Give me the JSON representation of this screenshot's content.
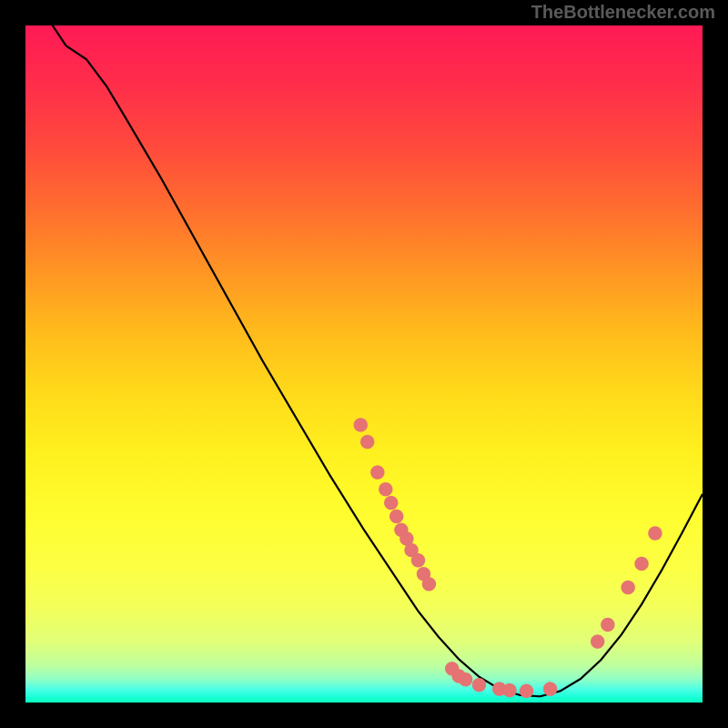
{
  "watermark": "TheBottlenecker.com",
  "chart_data": {
    "type": "line",
    "title": "",
    "xlabel": "",
    "ylabel": "",
    "xlim": [
      0,
      100
    ],
    "ylim": [
      0,
      100
    ],
    "background": {
      "gradient_stops": [
        {
          "offset": 0.0,
          "color": "#ff1a55"
        },
        {
          "offset": 0.09,
          "color": "#ff2e4a"
        },
        {
          "offset": 0.18,
          "color": "#ff4a3c"
        },
        {
          "offset": 0.27,
          "color": "#ff6d2f"
        },
        {
          "offset": 0.36,
          "color": "#ff9424"
        },
        {
          "offset": 0.45,
          "color": "#ffba1c"
        },
        {
          "offset": 0.54,
          "color": "#ffd91a"
        },
        {
          "offset": 0.63,
          "color": "#fff01f"
        },
        {
          "offset": 0.72,
          "color": "#fffd2f"
        },
        {
          "offset": 0.8,
          "color": "#fcff43"
        },
        {
          "offset": 0.86,
          "color": "#f3ff5a"
        },
        {
          "offset": 0.91,
          "color": "#e1ff78"
        },
        {
          "offset": 0.945,
          "color": "#bfff9e"
        },
        {
          "offset": 0.966,
          "color": "#8effc6"
        },
        {
          "offset": 0.98,
          "color": "#4effe6"
        },
        {
          "offset": 0.992,
          "color": "#18ffd8"
        },
        {
          "offset": 1.0,
          "color": "#0affbc"
        }
      ]
    },
    "curve": [
      {
        "x": 4.0,
        "y": 100.0
      },
      {
        "x": 6.0,
        "y": 97.0
      },
      {
        "x": 9.0,
        "y": 95.0
      },
      {
        "x": 12.0,
        "y": 91.0
      },
      {
        "x": 15.0,
        "y": 86.0
      },
      {
        "x": 20.0,
        "y": 77.5
      },
      {
        "x": 25.0,
        "y": 68.5
      },
      {
        "x": 30.0,
        "y": 59.5
      },
      {
        "x": 35.0,
        "y": 50.5
      },
      {
        "x": 40.0,
        "y": 42.0
      },
      {
        "x": 45.0,
        "y": 33.5
      },
      {
        "x": 50.0,
        "y": 25.5
      },
      {
        "x": 55.0,
        "y": 18.0
      },
      {
        "x": 58.0,
        "y": 13.5
      },
      {
        "x": 61.0,
        "y": 9.7
      },
      {
        "x": 64.0,
        "y": 6.4
      },
      {
        "x": 67.0,
        "y": 3.8
      },
      {
        "x": 70.0,
        "y": 2.0
      },
      {
        "x": 73.0,
        "y": 1.1
      },
      {
        "x": 76.0,
        "y": 0.9
      },
      {
        "x": 79.0,
        "y": 1.7
      },
      {
        "x": 82.0,
        "y": 3.5
      },
      {
        "x": 85.0,
        "y": 6.3
      },
      {
        "x": 88.0,
        "y": 10.0
      },
      {
        "x": 91.0,
        "y": 14.5
      },
      {
        "x": 94.0,
        "y": 19.6
      },
      {
        "x": 97.0,
        "y": 25.1
      },
      {
        "x": 100.0,
        "y": 30.8
      }
    ],
    "scatter": [
      {
        "x": 49.5,
        "y": 41.0
      },
      {
        "x": 50.5,
        "y": 38.5
      },
      {
        "x": 52.0,
        "y": 34.0
      },
      {
        "x": 53.2,
        "y": 31.5
      },
      {
        "x": 54.0,
        "y": 29.5
      },
      {
        "x": 54.8,
        "y": 27.5
      },
      {
        "x": 55.5,
        "y": 25.5
      },
      {
        "x": 56.3,
        "y": 24.2
      },
      {
        "x": 57.0,
        "y": 22.5
      },
      {
        "x": 58.0,
        "y": 21.0
      },
      {
        "x": 58.8,
        "y": 19.0
      },
      {
        "x": 59.6,
        "y": 17.5
      },
      {
        "x": 63.0,
        "y": 5.0
      },
      {
        "x": 64.0,
        "y": 3.9
      },
      {
        "x": 65.0,
        "y": 3.4
      },
      {
        "x": 67.0,
        "y": 2.6
      },
      {
        "x": 70.0,
        "y": 2.0
      },
      {
        "x": 71.5,
        "y": 1.8
      },
      {
        "x": 74.0,
        "y": 1.7
      },
      {
        "x": 77.5,
        "y": 2.0
      },
      {
        "x": 84.5,
        "y": 9.0
      },
      {
        "x": 86.0,
        "y": 11.5
      },
      {
        "x": 89.0,
        "y": 17.0
      },
      {
        "x": 91.0,
        "y": 20.5
      },
      {
        "x": 93.0,
        "y": 25.0
      }
    ],
    "colors": {
      "curve_stroke": "#000000",
      "point_fill": "#e57373",
      "point_stroke": "#e57373"
    }
  }
}
